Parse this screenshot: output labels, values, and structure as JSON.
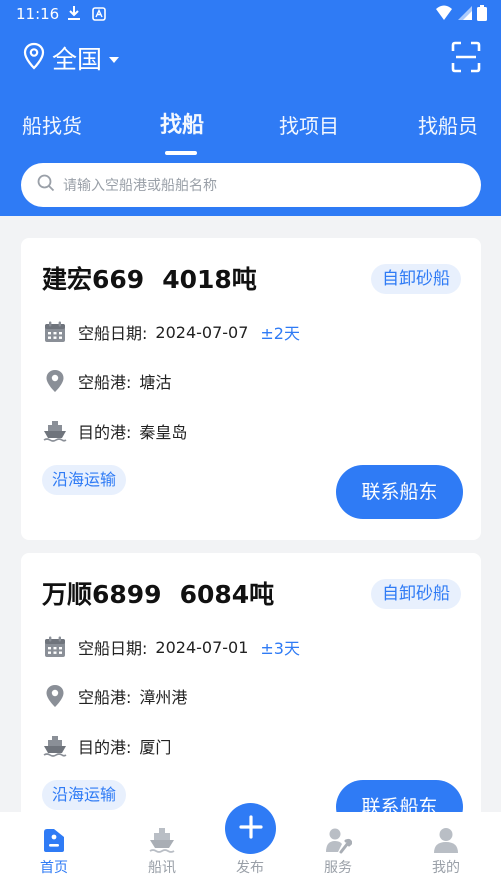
{
  "status": {
    "time": "11:16"
  },
  "location": {
    "label": "全国"
  },
  "tabs": [
    {
      "label": "船找货",
      "active": false
    },
    {
      "label": "找船",
      "active": true
    },
    {
      "label": "找项目",
      "active": false
    },
    {
      "label": "找船员",
      "active": false
    }
  ],
  "search": {
    "placeholder": "请输入空船港或船舶名称"
  },
  "ships": [
    {
      "name": "建宏669",
      "tonnage": "4018吨",
      "type": "自卸砂船",
      "empty_date_label": "空船日期:",
      "empty_date": "2024-07-07",
      "date_range": "±2天",
      "empty_port_label": "空船港:",
      "empty_port": "塘沽",
      "dest_port_label": "目的港:",
      "dest_port": "秦皇岛",
      "route": "沿海运输",
      "contact_label": "联系船东"
    },
    {
      "name": "万顺6899",
      "tonnage": "6084吨",
      "type": "自卸砂船",
      "empty_date_label": "空船日期:",
      "empty_date": "2024-07-01",
      "date_range": "±3天",
      "empty_port_label": "空船港:",
      "empty_port": "漳州港",
      "dest_port_label": "目的港:",
      "dest_port": "厦门",
      "route": "沿海运输",
      "contact_label": "联系船东"
    }
  ],
  "bottom_nav": [
    {
      "label": "首页",
      "icon": "home-icon",
      "active": true
    },
    {
      "label": "船讯",
      "icon": "ship-news-icon",
      "active": false
    },
    {
      "label": "发布",
      "icon": "plus-icon",
      "active": false
    },
    {
      "label": "服务",
      "icon": "service-icon",
      "active": false
    },
    {
      "label": "我的",
      "icon": "user-icon",
      "active": false
    }
  ],
  "colors": {
    "primary": "#2f7bf5",
    "tag_bg": "#e8f0fd",
    "page_bg": "#f2f3f5",
    "muted": "#9aa0a8"
  }
}
